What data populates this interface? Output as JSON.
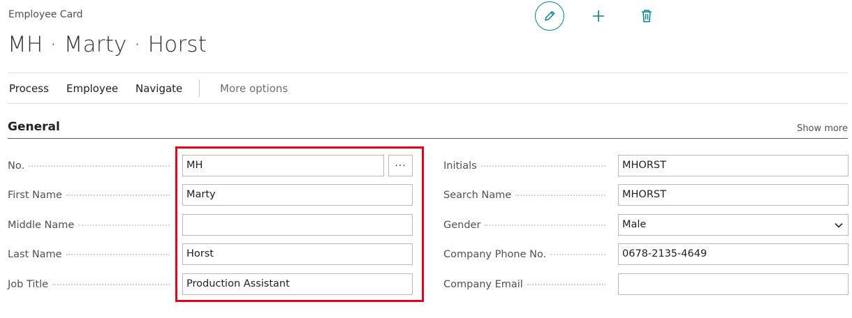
{
  "page": {
    "caption": "Employee Card",
    "title": "MH · Marty · Horst"
  },
  "actions": {
    "edit_icon": "pencil-icon",
    "add_icon": "plus-icon",
    "delete_icon": "trash-icon",
    "accent_color": "#00848c"
  },
  "menu": {
    "items": [
      "Process",
      "Employee",
      "Navigate"
    ],
    "more": "More options"
  },
  "section": {
    "title": "General",
    "show_more": "Show more"
  },
  "left_fields": [
    {
      "label": "No.",
      "value": "MH"
    },
    {
      "label": "First Name",
      "value": "Marty"
    },
    {
      "label": "Middle Name",
      "value": ""
    },
    {
      "label": "Last Name",
      "value": "Horst"
    },
    {
      "label": "Job Title",
      "value": "Production Assistant"
    }
  ],
  "lookup_button": "···",
  "right_fields": [
    {
      "label": "Initials",
      "value": "MHORST"
    },
    {
      "label": "Search Name",
      "value": "MHORST"
    },
    {
      "label": "Gender",
      "value": "Male"
    },
    {
      "label": "Company Phone No.",
      "value": "0678-2135-4649"
    },
    {
      "label": "Company Email",
      "value": ""
    }
  ],
  "highlight_color": "#e2001a"
}
